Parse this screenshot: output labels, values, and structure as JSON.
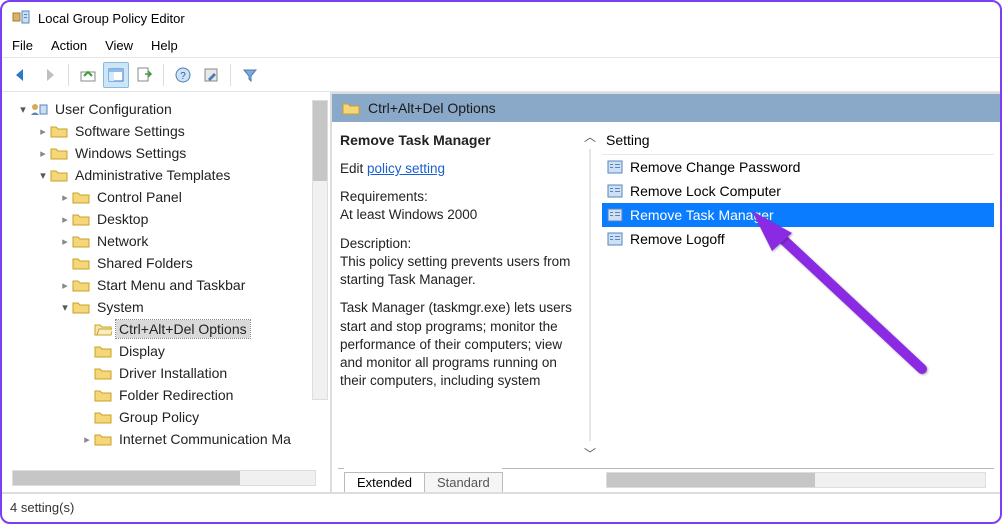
{
  "window": {
    "title": "Local Group Policy Editor"
  },
  "menu": {
    "file": "File",
    "action": "Action",
    "view": "View",
    "help": "Help"
  },
  "tree": {
    "root": "User Configuration",
    "software_settings": "Software Settings",
    "windows_settings": "Windows Settings",
    "admin_templates": "Administrative Templates",
    "control_panel": "Control Panel",
    "desktop": "Desktop",
    "network": "Network",
    "shared_folders": "Shared Folders",
    "start_menu": "Start Menu and Taskbar",
    "system": "System",
    "cad_options": "Ctrl+Alt+Del Options",
    "display": "Display",
    "driver_installation": "Driver Installation",
    "folder_redirection": "Folder Redirection",
    "group_policy": "Group Policy",
    "internet_comm": "Internet Communication Ma"
  },
  "breadcrumb": "Ctrl+Alt+Del Options",
  "detail": {
    "title": "Remove Task Manager",
    "edit_prefix": "Edit ",
    "edit_link": "policy setting ",
    "req_label": "Requirements:",
    "req_value": "At least Windows 2000",
    "desc_label": "Description:",
    "desc_1": "This policy setting prevents users from starting Task Manager.",
    "desc_2": "Task Manager (taskmgr.exe) lets users start and stop programs; monitor the performance of their computers; view and monitor all programs running on their computers, including system"
  },
  "list": {
    "header": "Setting",
    "items": [
      "Remove Change Password",
      "Remove Lock Computer",
      "Remove Task Manager",
      "Remove Logoff"
    ],
    "selected_index": 2
  },
  "tabs": {
    "extended": "Extended",
    "standard": "Standard"
  },
  "status": "4 setting(s)"
}
